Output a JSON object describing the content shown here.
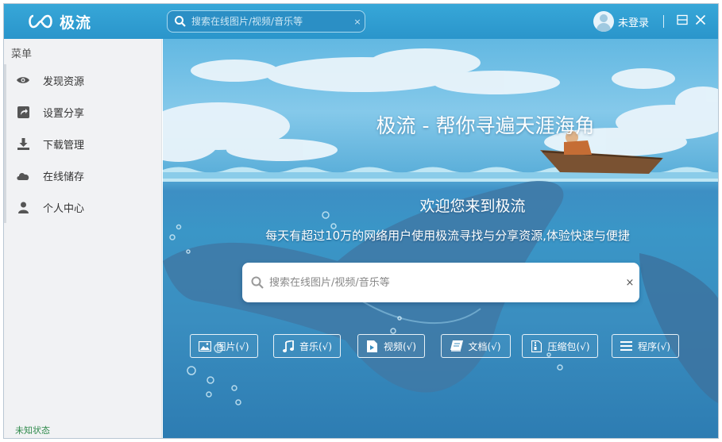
{
  "app": {
    "name": "极流"
  },
  "header": {
    "search_placeholder": "搜索在线图片/视频/音乐等",
    "clear": "×",
    "user_label": "未登录"
  },
  "sidebar": {
    "menu_label": "菜单",
    "items": [
      {
        "label": "发现资源",
        "icon": "eye-icon"
      },
      {
        "label": "设置分享",
        "icon": "share-icon"
      },
      {
        "label": "下载管理",
        "icon": "download-icon"
      },
      {
        "label": "在线储存",
        "icon": "cloud-icon"
      },
      {
        "label": "个人中心",
        "icon": "user-icon"
      }
    ],
    "status": "未知状态"
  },
  "hero": {
    "title": "极流 - 帮你寻遍天涯海角",
    "welcome": "欢迎您来到极流",
    "subtitle": "每天有超过10万的网络用户使用极流寻找与分享资源,体验快速与便捷",
    "search_placeholder": "搜索在线图片/视频/音乐等",
    "clear": "×"
  },
  "categories": [
    {
      "label": "图片(√)",
      "icon": "image-icon"
    },
    {
      "label": "音乐(√)",
      "icon": "music-icon"
    },
    {
      "label": "视频(√)",
      "icon": "video-icon"
    },
    {
      "label": "文档(√)",
      "icon": "document-icon"
    },
    {
      "label": "压缩包(√)",
      "icon": "archive-icon"
    },
    {
      "label": "程序(√)",
      "icon": "list-icon"
    }
  ],
  "colors": {
    "titlebar": "#2a95cb",
    "sidebar": "#f1f2f4",
    "status": "#2f8a4b"
  }
}
